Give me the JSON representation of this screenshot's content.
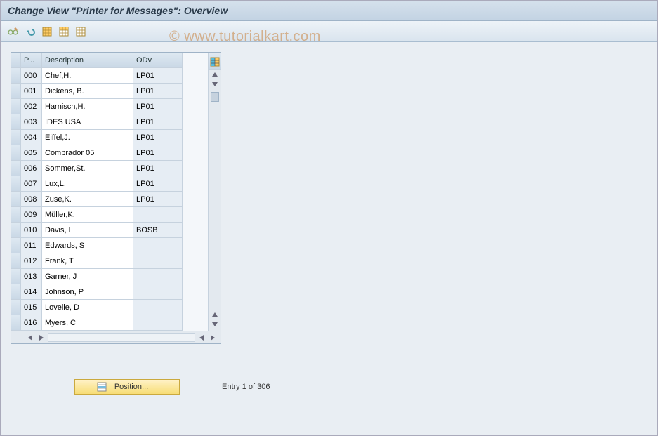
{
  "title": "Change View \"Printer for Messages\": Overview",
  "watermark": "© www.tutorialkart.com",
  "toolbar": {
    "display_change": "display-change",
    "undo": "undo",
    "select_all": "select-all",
    "select_block": "select-block",
    "deselect_all": "deselect-all"
  },
  "columns": {
    "p": "P...",
    "desc": "Description",
    "odv": "ODv"
  },
  "rows": [
    {
      "p": "000",
      "desc": "Chef,H.",
      "odv": "LP01"
    },
    {
      "p": "001",
      "desc": "Dickens, B.",
      "odv": "LP01"
    },
    {
      "p": "002",
      "desc": "Harnisch,H.",
      "odv": "LP01"
    },
    {
      "p": "003",
      "desc": "IDES USA",
      "odv": "LP01"
    },
    {
      "p": "004",
      "desc": "Eiffel,J.",
      "odv": "LP01"
    },
    {
      "p": "005",
      "desc": "Comprador 05",
      "odv": "LP01"
    },
    {
      "p": "006",
      "desc": "Sommer,St.",
      "odv": "LP01"
    },
    {
      "p": "007",
      "desc": "Lux,L.",
      "odv": "LP01"
    },
    {
      "p": "008",
      "desc": "Zuse,K.",
      "odv": "LP01"
    },
    {
      "p": "009",
      "desc": "Müller,K.",
      "odv": ""
    },
    {
      "p": "010",
      "desc": "Davis, L",
      "odv": "BOSB"
    },
    {
      "p": "011",
      "desc": "Edwards, S",
      "odv": ""
    },
    {
      "p": "012",
      "desc": "Frank, T",
      "odv": ""
    },
    {
      "p": "013",
      "desc": "Garner, J",
      "odv": ""
    },
    {
      "p": "014",
      "desc": "Johnson, P",
      "odv": ""
    },
    {
      "p": "015",
      "desc": "Lovelle, D",
      "odv": ""
    },
    {
      "p": "016",
      "desc": "Myers, C",
      "odv": ""
    }
  ],
  "footer": {
    "position_label": "Position...",
    "entry_info": "Entry 1 of 306"
  }
}
